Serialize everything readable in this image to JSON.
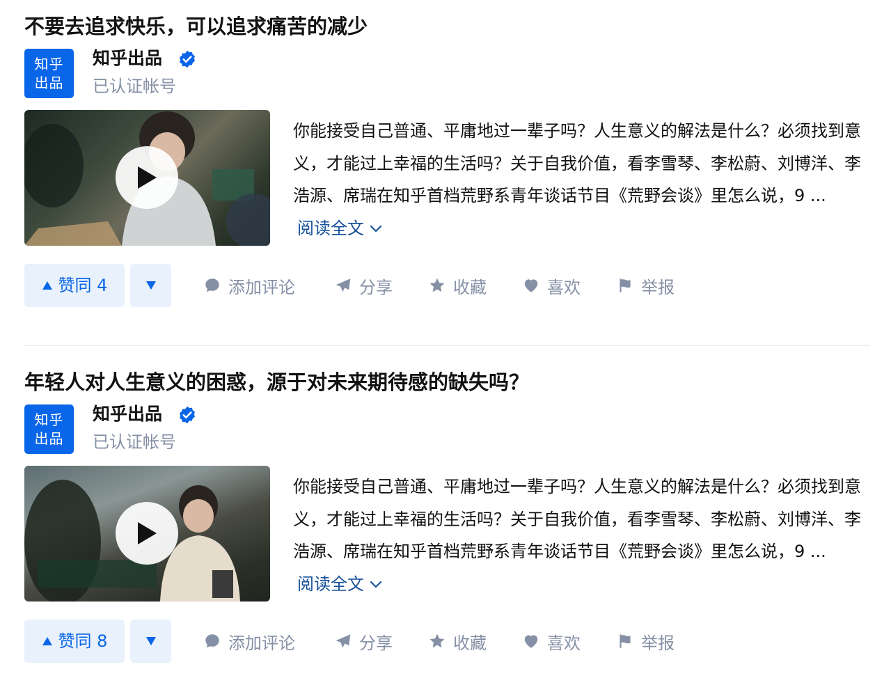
{
  "feed": {
    "items": [
      {
        "title": "不要去追求快乐，可以追求痛苦的减少",
        "author": {
          "avatar_line1": "知乎",
          "avatar_line2": "出品",
          "name": "知乎出品",
          "badge_text": "已认证帐号"
        },
        "excerpt": "你能接受自己普通、平庸地过一辈子吗？人生意义的解法是什么？必须找到意义，才能过上幸福的生活吗？关于自我价值，看李雪琴、李松蔚、刘博洋、李浩源、席瑞在知乎首档荒野系青年谈话节目《荒野会谈》里怎么说，9 ...",
        "read_more": "阅读全文",
        "vote_up_label": "赞同 4",
        "actions": {
          "comment": "添加评论",
          "share": "分享",
          "collect": "收藏",
          "like": "喜欢",
          "report": "举报"
        }
      },
      {
        "title": "年轻人对人生意义的困惑，源于对未来期待感的缺失吗？",
        "author": {
          "avatar_line1": "知乎",
          "avatar_line2": "出品",
          "name": "知乎出品",
          "badge_text": "已认证帐号"
        },
        "excerpt": "你能接受自己普通、平庸地过一辈子吗？人生意义的解法是什么？必须找到意义，才能过上幸福的生活吗？关于自我价值，看李雪琴、李松蔚、刘博洋、李浩源、席瑞在知乎首档荒野系青年谈话节目《荒野会谈》里怎么说，9 ...",
        "read_more": "阅读全文",
        "vote_up_label": "赞同 8",
        "actions": {
          "comment": "添加评论",
          "share": "分享",
          "collect": "收藏",
          "like": "喜欢",
          "report": "举报"
        }
      }
    ]
  },
  "icons": {
    "verified": "verified-check-icon",
    "play": "play-icon",
    "vote_down": "triangle-down-icon",
    "comment": "comment-bubble-icon",
    "share": "paper-plane-icon",
    "collect": "star-icon",
    "like": "heart-icon",
    "report": "flag-icon",
    "expand": "chevron-down-icon"
  },
  "colors": {
    "brand_blue": "#0a66e8",
    "vote_bg": "#e8f1fc",
    "link_blue": "#175199",
    "muted_gray": "#8590a6",
    "text": "#121212"
  }
}
